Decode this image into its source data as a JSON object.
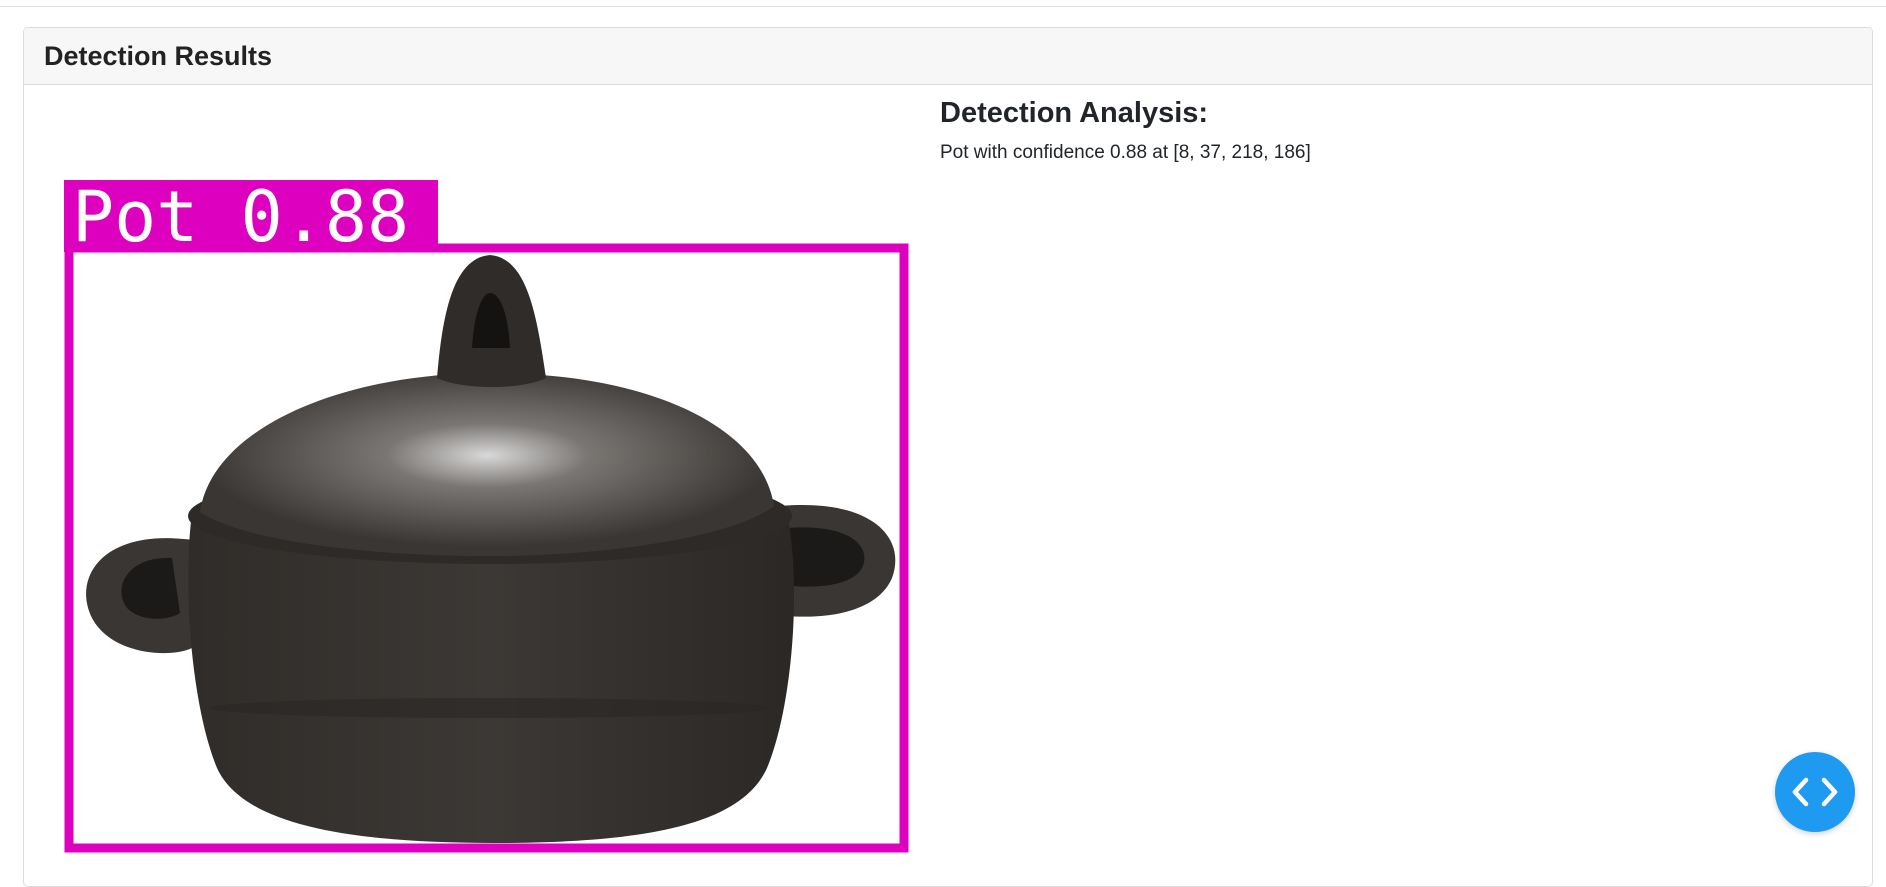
{
  "card": {
    "title": "Detection Results"
  },
  "detection_image": {
    "box_label": "Pot 0.88",
    "box_color": "#de00bf",
    "subject": "pot"
  },
  "analysis": {
    "heading": "Detection Analysis:",
    "results": [
      "Pot with confidence 0.88 at [8, 37, 218, 186]"
    ]
  },
  "fab": {
    "icon": "code-brackets-icon",
    "color": "#1e9bf0"
  }
}
